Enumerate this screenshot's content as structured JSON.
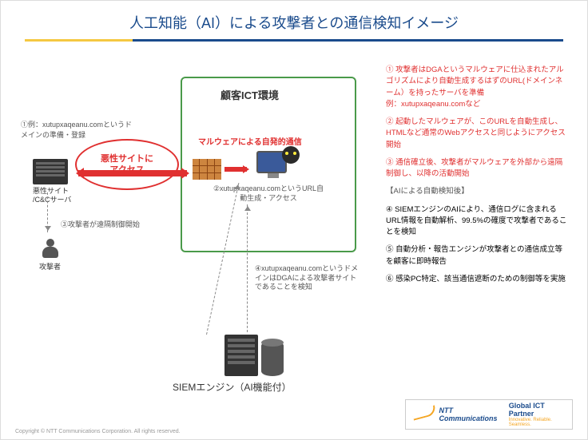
{
  "title": "人工知能（AI）による攻撃者との通信検知イメージ",
  "notes": {
    "n1": "①例：xutupxaqeanu.comというドメインの準備・登録",
    "n2": "②xutupxaqeanu.comというURL自動生成・アクセス",
    "n3": "③攻撃者が遠隔制御開始",
    "n4": "④xutupxaqeanu.comというドメインはDGAによる攻撃者サイトであることを検知"
  },
  "labels": {
    "malsite": "悪性サイト\n/C&Cサーバ",
    "attacker": "攻撃者",
    "redcircle": "悪性サイトに\nアクセス",
    "ict": "顧客ICT環境",
    "malware": "マルウェアによる自発的通信",
    "siem": "SIEMエンジン（AI機能付）"
  },
  "steps": {
    "s1": "① 攻撃者はDGAというマルウェアに仕込まれたアルゴリズムにより自動生成するはずのURL(ドメインネーム）を持ったサーバを準備\n例：xutupxaqeanu.comなど",
    "s2": "② 起動したマルウェアが、このURLを自動生成し、HTMLなど通常のWebアクセスと同じようにアクセス開始",
    "s3": "③ 通信確立後、攻撃者がマルウェアを外部から遠隔制御し、以降の活動開始",
    "sub": "【AIによる自動検知後】",
    "s4": "④ SIEMエンジンのAIにより、通信ログに含まれるURL情報を自動解析、99.5%の確度で攻撃者であることを検知",
    "s5": "⑤ 自動分析・報告エンジンが攻撃者との通信成立等を顧客に即時報告",
    "s6": "⑥ 感染PC特定、該当通信遮断のための制御等を実施"
  },
  "footer": {
    "copyright": "Copyright © NTT Communications Corporation. All rights reserved.",
    "brand": "NTT Communications",
    "partner": "Global ICT Partner",
    "tagline": "Innovative. Reliable. Seamless."
  }
}
